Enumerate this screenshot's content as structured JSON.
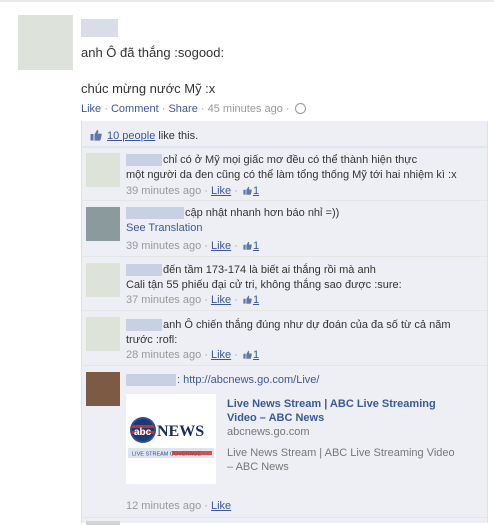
{
  "post": {
    "line1": "anh Ô đã thắng :sogood:",
    "line2": "chúc mừng nước Mỹ :x",
    "actions": {
      "like": "Like",
      "comment": "Comment",
      "share": "Share",
      "time": "45 minutes ago"
    }
  },
  "likes": {
    "count_text": "10 people",
    "suffix": " like this."
  },
  "comments": [
    {
      "text1": "chỉ có ở Mỹ mọi giấc mơ đều có thể thành hiện thực",
      "text2": "một người da đen cũng có thể làm tổng thống Mỹ tới hai nhiệm kì :x",
      "time": "39 minutes ago",
      "like": "Like",
      "likes": "1"
    },
    {
      "text1": "cập nhật nhanh hơn báo nhỉ =))",
      "translation": "See Translation",
      "time": "39 minutes ago",
      "like": "Like",
      "likes": "1"
    },
    {
      "text1": "đến tầm 173-174 là biết ai thắng rồi mà anh",
      "text2": "Cali tận 55 phiếu đại cử tri, không thắng sao được :sure:",
      "time": "37 minutes ago",
      "like": "Like",
      "likes": "1"
    },
    {
      "text1": "anh Ô chiến thắng đúng như dự đoán của đa số từ cả năm",
      "text2": "trước :rofl:",
      "time": "28 minutes ago",
      "like": "Like",
      "likes": "1"
    },
    {
      "url": ": http://abcnews.go.com/Live/",
      "preview": {
        "title": "Live News Stream | ABC Live Streaming Video – ABC News",
        "domain": "abcnews.go.com",
        "description": "Live News Stream | ABC Live Streaming Video – ABC News",
        "logo_text": "NEWS",
        "logo_caption": "LIVE STREAM COVERAGE"
      },
      "time": "12 minutes ago",
      "like": "Like"
    }
  ],
  "colors": {
    "link": "#3b5998",
    "comment_bg": "#edeff4"
  }
}
